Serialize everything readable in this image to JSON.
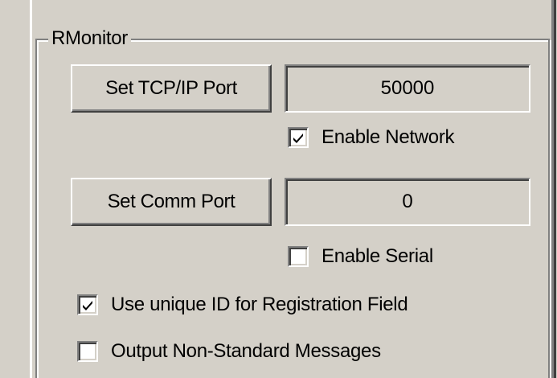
{
  "group": {
    "title": "RMonitor"
  },
  "network": {
    "set_port_button": "Set TCP/IP Port",
    "port_value": "50000",
    "enable_label": "Enable Network",
    "enable_checked": true
  },
  "serial": {
    "set_port_button": "Set Comm Port",
    "port_value": "0",
    "enable_label": "Enable Serial",
    "enable_checked": false
  },
  "options": [
    {
      "label": "Use unique ID for Registration Field",
      "checked": true
    },
    {
      "label": "Output Non-Standard Messages",
      "checked": false
    }
  ],
  "icons": {
    "checkmark": "check-icon"
  },
  "colors": {
    "face": "#d4d0c8",
    "shadow": "#808080",
    "highlight": "#ffffff",
    "dark_shadow": "#404040"
  }
}
